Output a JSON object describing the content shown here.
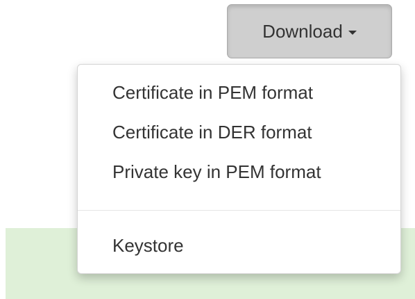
{
  "download_button": {
    "label": "Download",
    "icon": "caret-down-icon"
  },
  "dropdown_menu": {
    "items": [
      {
        "label": "Certificate in PEM format"
      },
      {
        "label": "Certificate in DER format"
      },
      {
        "label": "Private key in PEM format"
      }
    ],
    "footer_items": [
      {
        "label": "Keystore"
      }
    ]
  },
  "colors": {
    "button_bg": "#cfcfcf",
    "text": "#333333",
    "panel_bg": "#dff0d8",
    "menu_bg": "#ffffff"
  }
}
